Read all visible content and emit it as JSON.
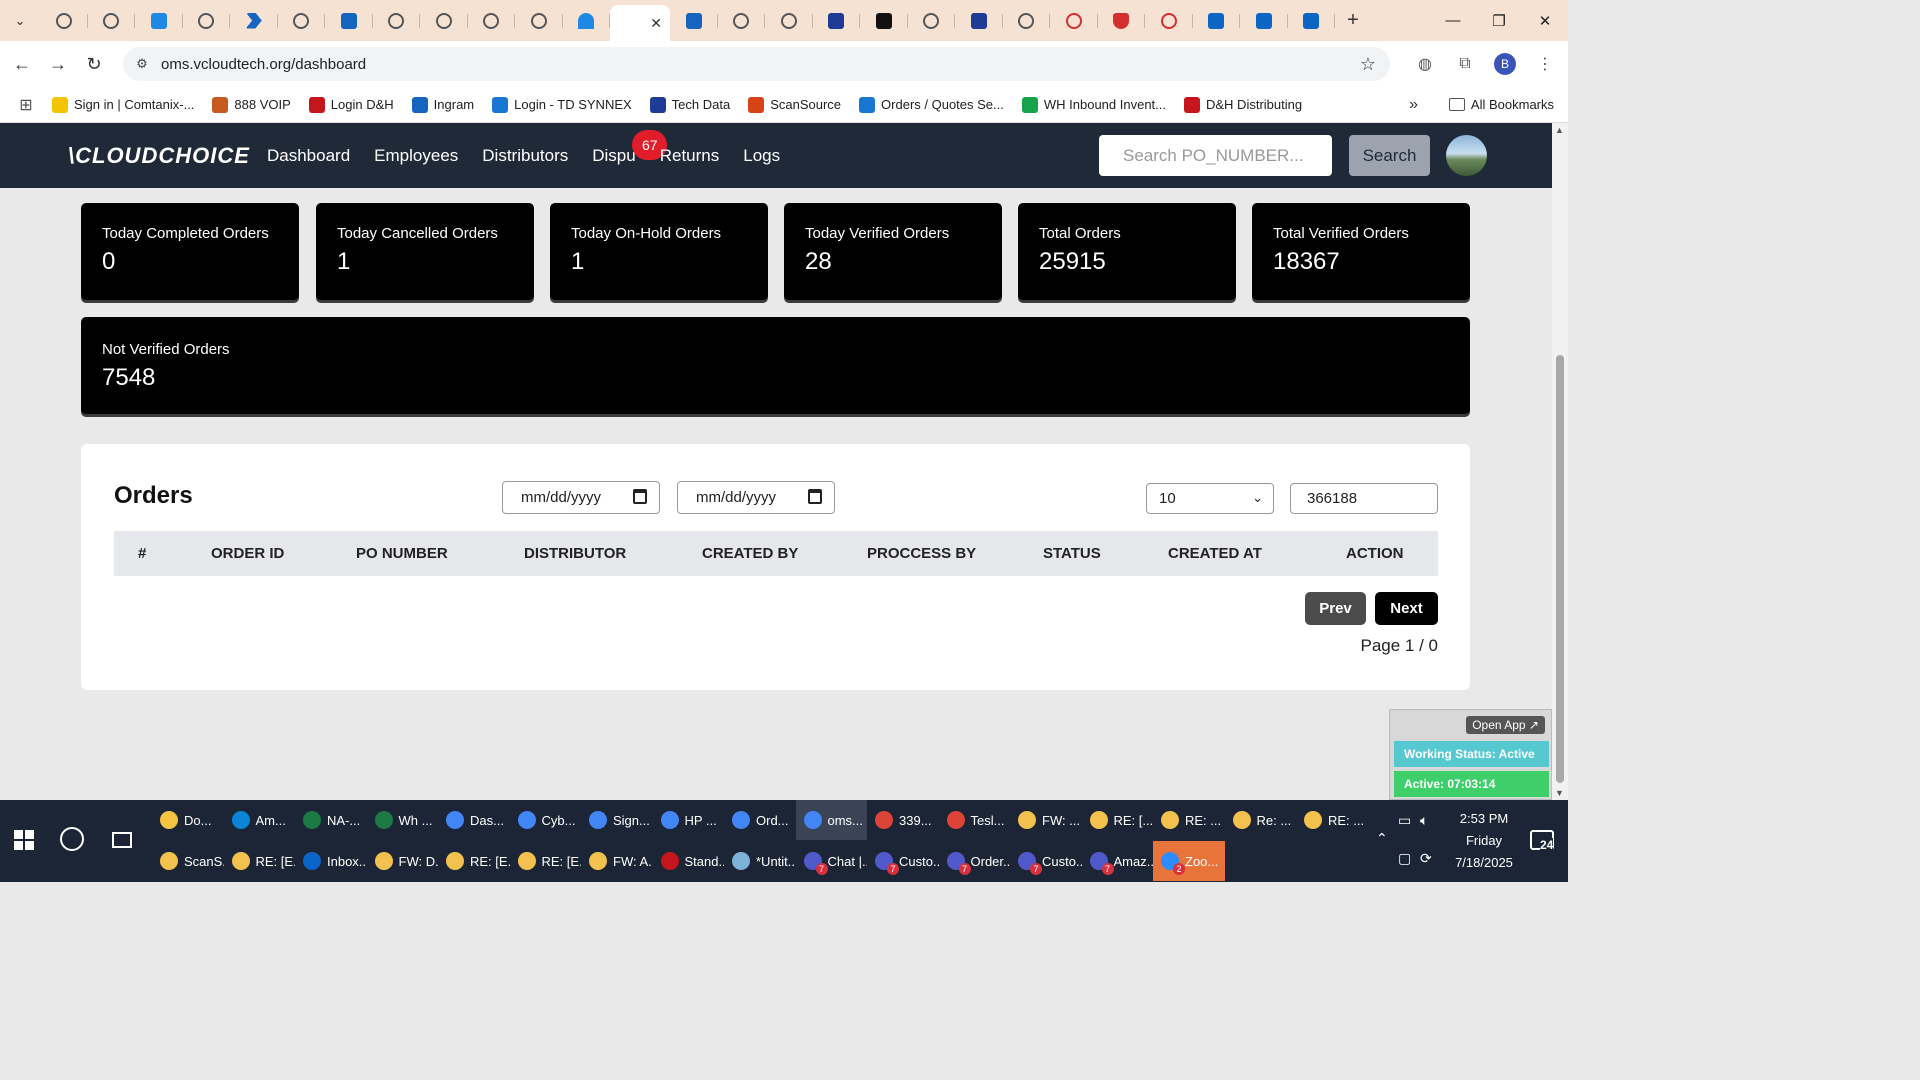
{
  "browser": {
    "url": "oms.vcloudtech.org/dashboard",
    "bookmarks": [
      {
        "label": "Sign in | Comtanix-...",
        "color": "#f5c400"
      },
      {
        "label": "888 VOIP",
        "color": "#c85a1e"
      },
      {
        "label": "Login D&H",
        "color": "#c4161c"
      },
      {
        "label": "Ingram",
        "color": "#1565c0"
      },
      {
        "label": "Login - TD SYNNEX",
        "color": "#1976d2"
      },
      {
        "label": "Tech Data",
        "color": "#1e3c96"
      },
      {
        "label": "ScanSource",
        "color": "#d84315"
      },
      {
        "label": "Orders / Quotes Se...",
        "color": "#1976d2"
      },
      {
        "label": "WH Inbound Invent...",
        "color": "#16a34a"
      },
      {
        "label": "D&H Distributing",
        "color": "#c4161c"
      }
    ],
    "all_bookmarks_label": "All Bookmarks",
    "profile_initial": "B"
  },
  "app": {
    "logo": "\\CLOUDCHOICE",
    "nav": {
      "dashboard": "Dashboard",
      "employees": "Employees",
      "distributors": "Distributors",
      "disputes": "Dispu",
      "disputes_badge": "67",
      "returns": "Returns",
      "logs": "Logs"
    },
    "search": {
      "placeholder": "Search PO_NUMBER...",
      "button": "Search"
    }
  },
  "stats": [
    {
      "label": "Today Completed Orders",
      "value": "0"
    },
    {
      "label": "Today Cancelled Orders",
      "value": "1"
    },
    {
      "label": "Today On-Hold Orders",
      "value": "1"
    },
    {
      "label": "Today Verified Orders",
      "value": "28"
    },
    {
      "label": "Total Orders",
      "value": "25915"
    },
    {
      "label": "Total Verified Orders",
      "value": "18367"
    }
  ],
  "not_verified": {
    "label": "Not Verified Orders",
    "value": "7548"
  },
  "orders": {
    "title": "Orders",
    "date_from": "mm/dd/yyyy",
    "date_to": "mm/dd/yyyy",
    "page_size": "10",
    "search_value": "366188",
    "columns": [
      "#",
      "ORDER ID",
      "PO NUMBER",
      "DISTRIBUTOR",
      "CREATED BY",
      "PROCCESS BY",
      "STATUS",
      "CREATED AT",
      "ACTION"
    ],
    "prev": "Prev",
    "next": "Next",
    "page_info": "Page 1 / 0"
  },
  "widget": {
    "open_app": "Open App ↗",
    "working_status": "Working Status: Active",
    "active_time": "Active: 07:03:14"
  },
  "taskbar": {
    "row1": [
      {
        "label": "Do...",
        "color": "#f5c542"
      },
      {
        "label": "Am...",
        "color": "#0a84d6"
      },
      {
        "label": "NA-...",
        "color": "#1d7a45"
      },
      {
        "label": "Wh ...",
        "color": "#1d7a45"
      },
      {
        "label": "Das...",
        "color": "#4285f4"
      },
      {
        "label": "Cyb...",
        "color": "#4285f4"
      },
      {
        "label": "Sign...",
        "color": "#4285f4"
      },
      {
        "label": "HP ...",
        "color": "#4285f4"
      },
      {
        "label": "Ord...",
        "color": "#4285f4"
      },
      {
        "label": "oms...",
        "color": "#4285f4"
      },
      {
        "label": "339...",
        "color": "#db4437"
      },
      {
        "label": "Tesl...",
        "color": "#db4437"
      },
      {
        "label": "FW: ...",
        "color": "#f2c14e"
      },
      {
        "label": "RE: [...",
        "color": "#f2c14e"
      },
      {
        "label": "RE: ...",
        "color": "#f2c14e"
      },
      {
        "label": "Re: ...",
        "color": "#f2c14e"
      },
      {
        "label": "RE: ...",
        "color": "#f2c14e"
      }
    ],
    "row2": [
      {
        "label": "ScanS...",
        "color": "#f2c14e"
      },
      {
        "label": "RE: [E...",
        "color": "#f2c14e"
      },
      {
        "label": "Inbox...",
        "color": "#0a64c8"
      },
      {
        "label": "FW: D...",
        "color": "#f2c14e"
      },
      {
        "label": "RE: [E...",
        "color": "#f2c14e"
      },
      {
        "label": "RE: [E...",
        "color": "#f2c14e"
      },
      {
        "label": "FW: A...",
        "color": "#f2c14e"
      },
      {
        "label": "Stand...",
        "color": "#c4161c"
      },
      {
        "label": "*Untit...",
        "color": "#7fb2d8"
      },
      {
        "label": "Chat |...",
        "color": "#5059c9",
        "count": "7"
      },
      {
        "label": "Custo...",
        "color": "#5059c9",
        "count": "7"
      },
      {
        "label": "Order...",
        "color": "#5059c9",
        "count": "7"
      },
      {
        "label": "Custo...",
        "color": "#5059c9",
        "count": "7"
      },
      {
        "label": "Amaz...",
        "color": "#5059c9",
        "count": "7"
      },
      {
        "label": "Zoo...",
        "color": "#2d8cff",
        "count": "2"
      }
    ],
    "time": "2:53 PM",
    "day": "Friday",
    "date": "7/18/2025",
    "notifications": "24"
  }
}
